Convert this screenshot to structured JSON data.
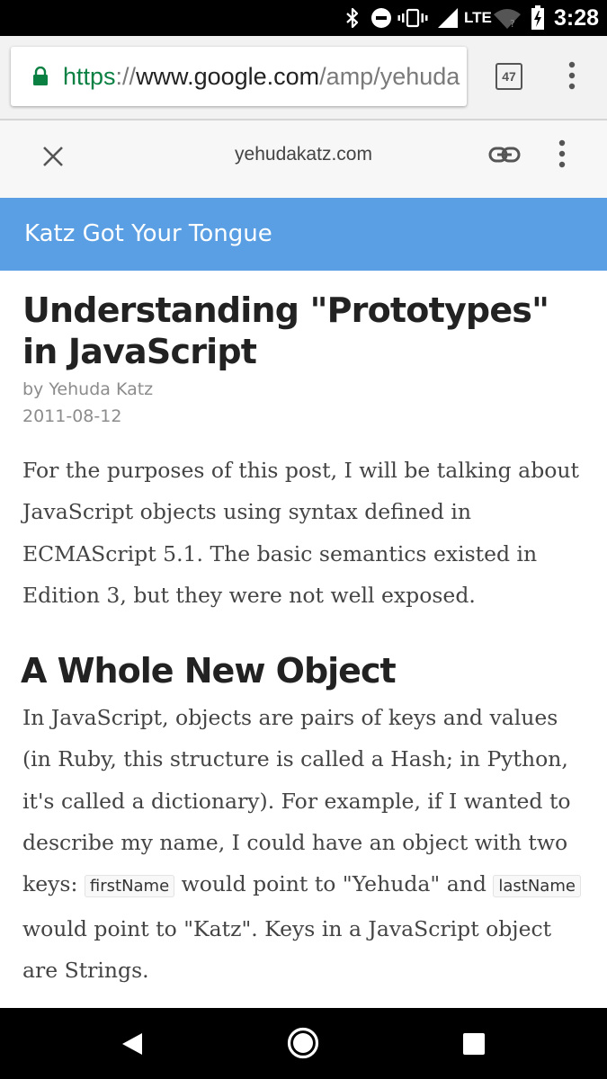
{
  "status_bar": {
    "time": "3:28",
    "network": "LTE",
    "icons": [
      "bluetooth-icon",
      "do-not-disturb-icon",
      "vibrate-icon",
      "signal-icon",
      "wifi-icon",
      "battery-charging-icon"
    ]
  },
  "browser": {
    "url_scheme": "https",
    "url_sep": "://",
    "url_host": "www.google.com",
    "url_path": "/amp/yehuda",
    "tab_count": "47",
    "icons": [
      "lock-icon",
      "overflow-menu-icon"
    ]
  },
  "custom_tab": {
    "domain": "yehudakatz.com",
    "icons": [
      "close-icon",
      "link-icon",
      "overflow-menu-icon"
    ]
  },
  "site": {
    "title": "Katz Got Your Tongue",
    "banner_color": "#5a9fe3"
  },
  "article": {
    "title": "Understanding \"Prototypes\" in JavaScript",
    "author": "by Yehuda Katz",
    "date": "2011-08-12",
    "intro": "For the purposes of this post, I will be talking about JavaScript objects using syntax defined in ECMAScript 5.1. The basic semantics existed in Edition 3, but they were not well exposed.",
    "section_heading": "A Whole New Object",
    "section_text_1": "In JavaScript, objects are pairs of keys and values (in Ruby, this structure is called a Hash; in Python, it's called a dictionary). For example, if I wanted to describe my name, I could have an object with two keys:",
    "code_1": "firstName",
    "section_text_2": "would point to \"Yehuda\" and",
    "code_2": "lastName",
    "section_text_3": "would point to \"Katz\". Keys in a JavaScript object are Strings."
  },
  "nav_bar": {
    "icons": [
      "back-icon",
      "home-icon",
      "recents-icon"
    ]
  }
}
